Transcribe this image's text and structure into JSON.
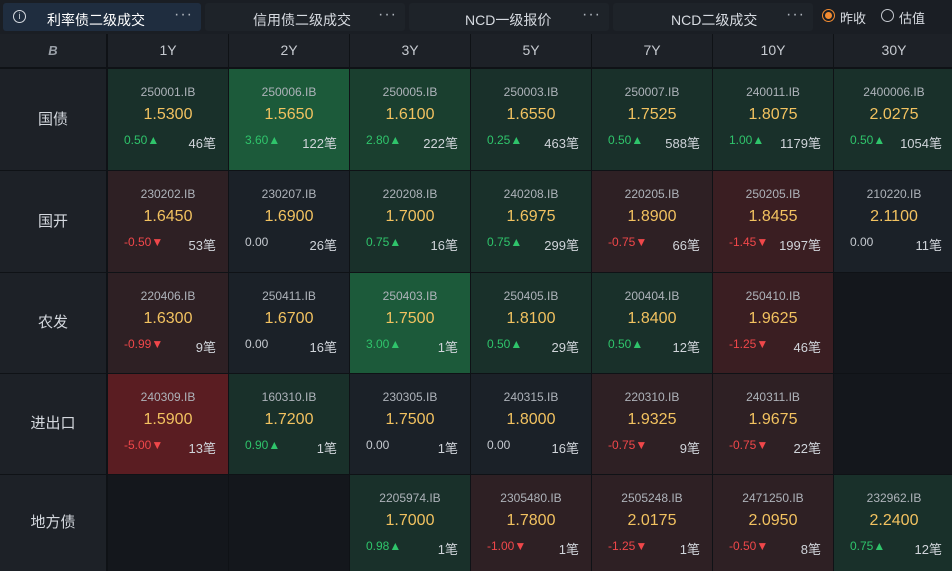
{
  "tabs": [
    {
      "label": "利率债二级成交",
      "active": true
    },
    {
      "label": "信用债二级成交",
      "active": false
    },
    {
      "label": "NCD一级报价",
      "active": false
    },
    {
      "label": "NCD二级成交",
      "active": false
    }
  ],
  "more_label": "···",
  "info_icon": "i",
  "radios": [
    {
      "label": "昨收",
      "selected": true
    },
    {
      "label": "估值",
      "selected": false
    }
  ],
  "corner_icon": "B",
  "tenors": [
    "1Y",
    "2Y",
    "3Y",
    "5Y",
    "7Y",
    "10Y",
    "30Y"
  ],
  "colors": {
    "up_strong": "#1c5a3a",
    "up_mid": "#1a3f2f",
    "up_soft": "#19302a",
    "neutral": "#1b2128",
    "down_soft": "#2e2024",
    "down_mid": "#3a1e22",
    "down_strong": "#5a1d22",
    "yield": "#f2c260",
    "up_text": "#2fc46b",
    "down_text": "#f0474a"
  },
  "rows": [
    {
      "label": "国债",
      "cells": [
        {
          "code": "250001.IB",
          "yield": "1.5300",
          "change": "0.50▲",
          "count": "46笔",
          "dir": "up",
          "tone": "up_soft"
        },
        {
          "code": "250006.IB",
          "yield": "1.5650",
          "change": "3.60▲",
          "count": "122笔",
          "dir": "up",
          "tone": "up_strong"
        },
        {
          "code": "250005.IB",
          "yield": "1.6100",
          "change": "2.80▲",
          "count": "222笔",
          "dir": "up",
          "tone": "up_mid"
        },
        {
          "code": "250003.IB",
          "yield": "1.6550",
          "change": "0.25▲",
          "count": "463笔",
          "dir": "up",
          "tone": "up_soft"
        },
        {
          "code": "250007.IB",
          "yield": "1.7525",
          "change": "0.50▲",
          "count": "588笔",
          "dir": "up",
          "tone": "up_soft"
        },
        {
          "code": "240011.IB",
          "yield": "1.8075",
          "change": "1.00▲",
          "count": "1179笔",
          "dir": "up",
          "tone": "up_soft"
        },
        {
          "code": "2400006.IB",
          "yield": "2.0275",
          "change": "0.50▲",
          "count": "1054笔",
          "dir": "up",
          "tone": "up_soft"
        }
      ]
    },
    {
      "label": "国开",
      "cells": [
        {
          "code": "230202.IB",
          "yield": "1.6450",
          "change": "-0.50▼",
          "count": "53笔",
          "dir": "down",
          "tone": "down_soft"
        },
        {
          "code": "230207.IB",
          "yield": "1.6900",
          "change": "0.00",
          "count": "26笔",
          "dir": "flat",
          "tone": "neutral"
        },
        {
          "code": "220208.IB",
          "yield": "1.7000",
          "change": "0.75▲",
          "count": "16笔",
          "dir": "up",
          "tone": "up_soft"
        },
        {
          "code": "240208.IB",
          "yield": "1.6975",
          "change": "0.75▲",
          "count": "299笔",
          "dir": "up",
          "tone": "up_soft"
        },
        {
          "code": "220205.IB",
          "yield": "1.8900",
          "change": "-0.75▼",
          "count": "66笔",
          "dir": "down",
          "tone": "down_soft"
        },
        {
          "code": "250205.IB",
          "yield": "1.8455",
          "change": "-1.45▼",
          "count": "1997笔",
          "dir": "down",
          "tone": "down_mid"
        },
        {
          "code": "210220.IB",
          "yield": "2.1100",
          "change": "0.00",
          "count": "11笔",
          "dir": "flat",
          "tone": "neutral"
        }
      ]
    },
    {
      "label": "农发",
      "cells": [
        {
          "code": "220406.IB",
          "yield": "1.6300",
          "change": "-0.99▼",
          "count": "9笔",
          "dir": "down",
          "tone": "down_soft"
        },
        {
          "code": "250411.IB",
          "yield": "1.6700",
          "change": "0.00",
          "count": "16笔",
          "dir": "flat",
          "tone": "neutral"
        },
        {
          "code": "250403.IB",
          "yield": "1.7500",
          "change": "3.00▲",
          "count": "1笔",
          "dir": "up",
          "tone": "up_strong"
        },
        {
          "code": "250405.IB",
          "yield": "1.8100",
          "change": "0.50▲",
          "count": "29笔",
          "dir": "up",
          "tone": "up_soft"
        },
        {
          "code": "200404.IB",
          "yield": "1.8400",
          "change": "0.50▲",
          "count": "12笔",
          "dir": "up",
          "tone": "up_soft"
        },
        {
          "code": "250410.IB",
          "yield": "1.9625",
          "change": "-1.25▼",
          "count": "46笔",
          "dir": "down",
          "tone": "down_mid"
        },
        null
      ]
    },
    {
      "label": "进出口",
      "cells": [
        {
          "code": "240309.IB",
          "yield": "1.5900",
          "change": "-5.00▼",
          "count": "13笔",
          "dir": "down",
          "tone": "down_strong"
        },
        {
          "code": "160310.IB",
          "yield": "1.7200",
          "change": "0.90▲",
          "count": "1笔",
          "dir": "up",
          "tone": "up_soft"
        },
        {
          "code": "230305.IB",
          "yield": "1.7500",
          "change": "0.00",
          "count": "1笔",
          "dir": "flat",
          "tone": "neutral"
        },
        {
          "code": "240315.IB",
          "yield": "1.8000",
          "change": "0.00",
          "count": "16笔",
          "dir": "flat",
          "tone": "neutral"
        },
        {
          "code": "220310.IB",
          "yield": "1.9325",
          "change": "-0.75▼",
          "count": "9笔",
          "dir": "down",
          "tone": "down_soft"
        },
        {
          "code": "240311.IB",
          "yield": "1.9675",
          "change": "-0.75▼",
          "count": "22笔",
          "dir": "down",
          "tone": "down_soft"
        },
        null
      ]
    },
    {
      "label": "地方债",
      "cells": [
        null,
        null,
        {
          "code": "2205974.IB",
          "yield": "1.7000",
          "change": "0.98▲",
          "count": "1笔",
          "dir": "up",
          "tone": "up_soft"
        },
        {
          "code": "2305480.IB",
          "yield": "1.7800",
          "change": "-1.00▼",
          "count": "1笔",
          "dir": "down",
          "tone": "down_soft"
        },
        {
          "code": "2505248.IB",
          "yield": "2.0175",
          "change": "-1.25▼",
          "count": "1笔",
          "dir": "down",
          "tone": "down_soft"
        },
        {
          "code": "2471250.IB",
          "yield": "2.0950",
          "change": "-0.50▼",
          "count": "8笔",
          "dir": "down",
          "tone": "down_soft"
        },
        {
          "code": "232962.IB",
          "yield": "2.2400",
          "change": "0.75▲",
          "count": "12笔",
          "dir": "up",
          "tone": "up_soft"
        }
      ]
    }
  ]
}
